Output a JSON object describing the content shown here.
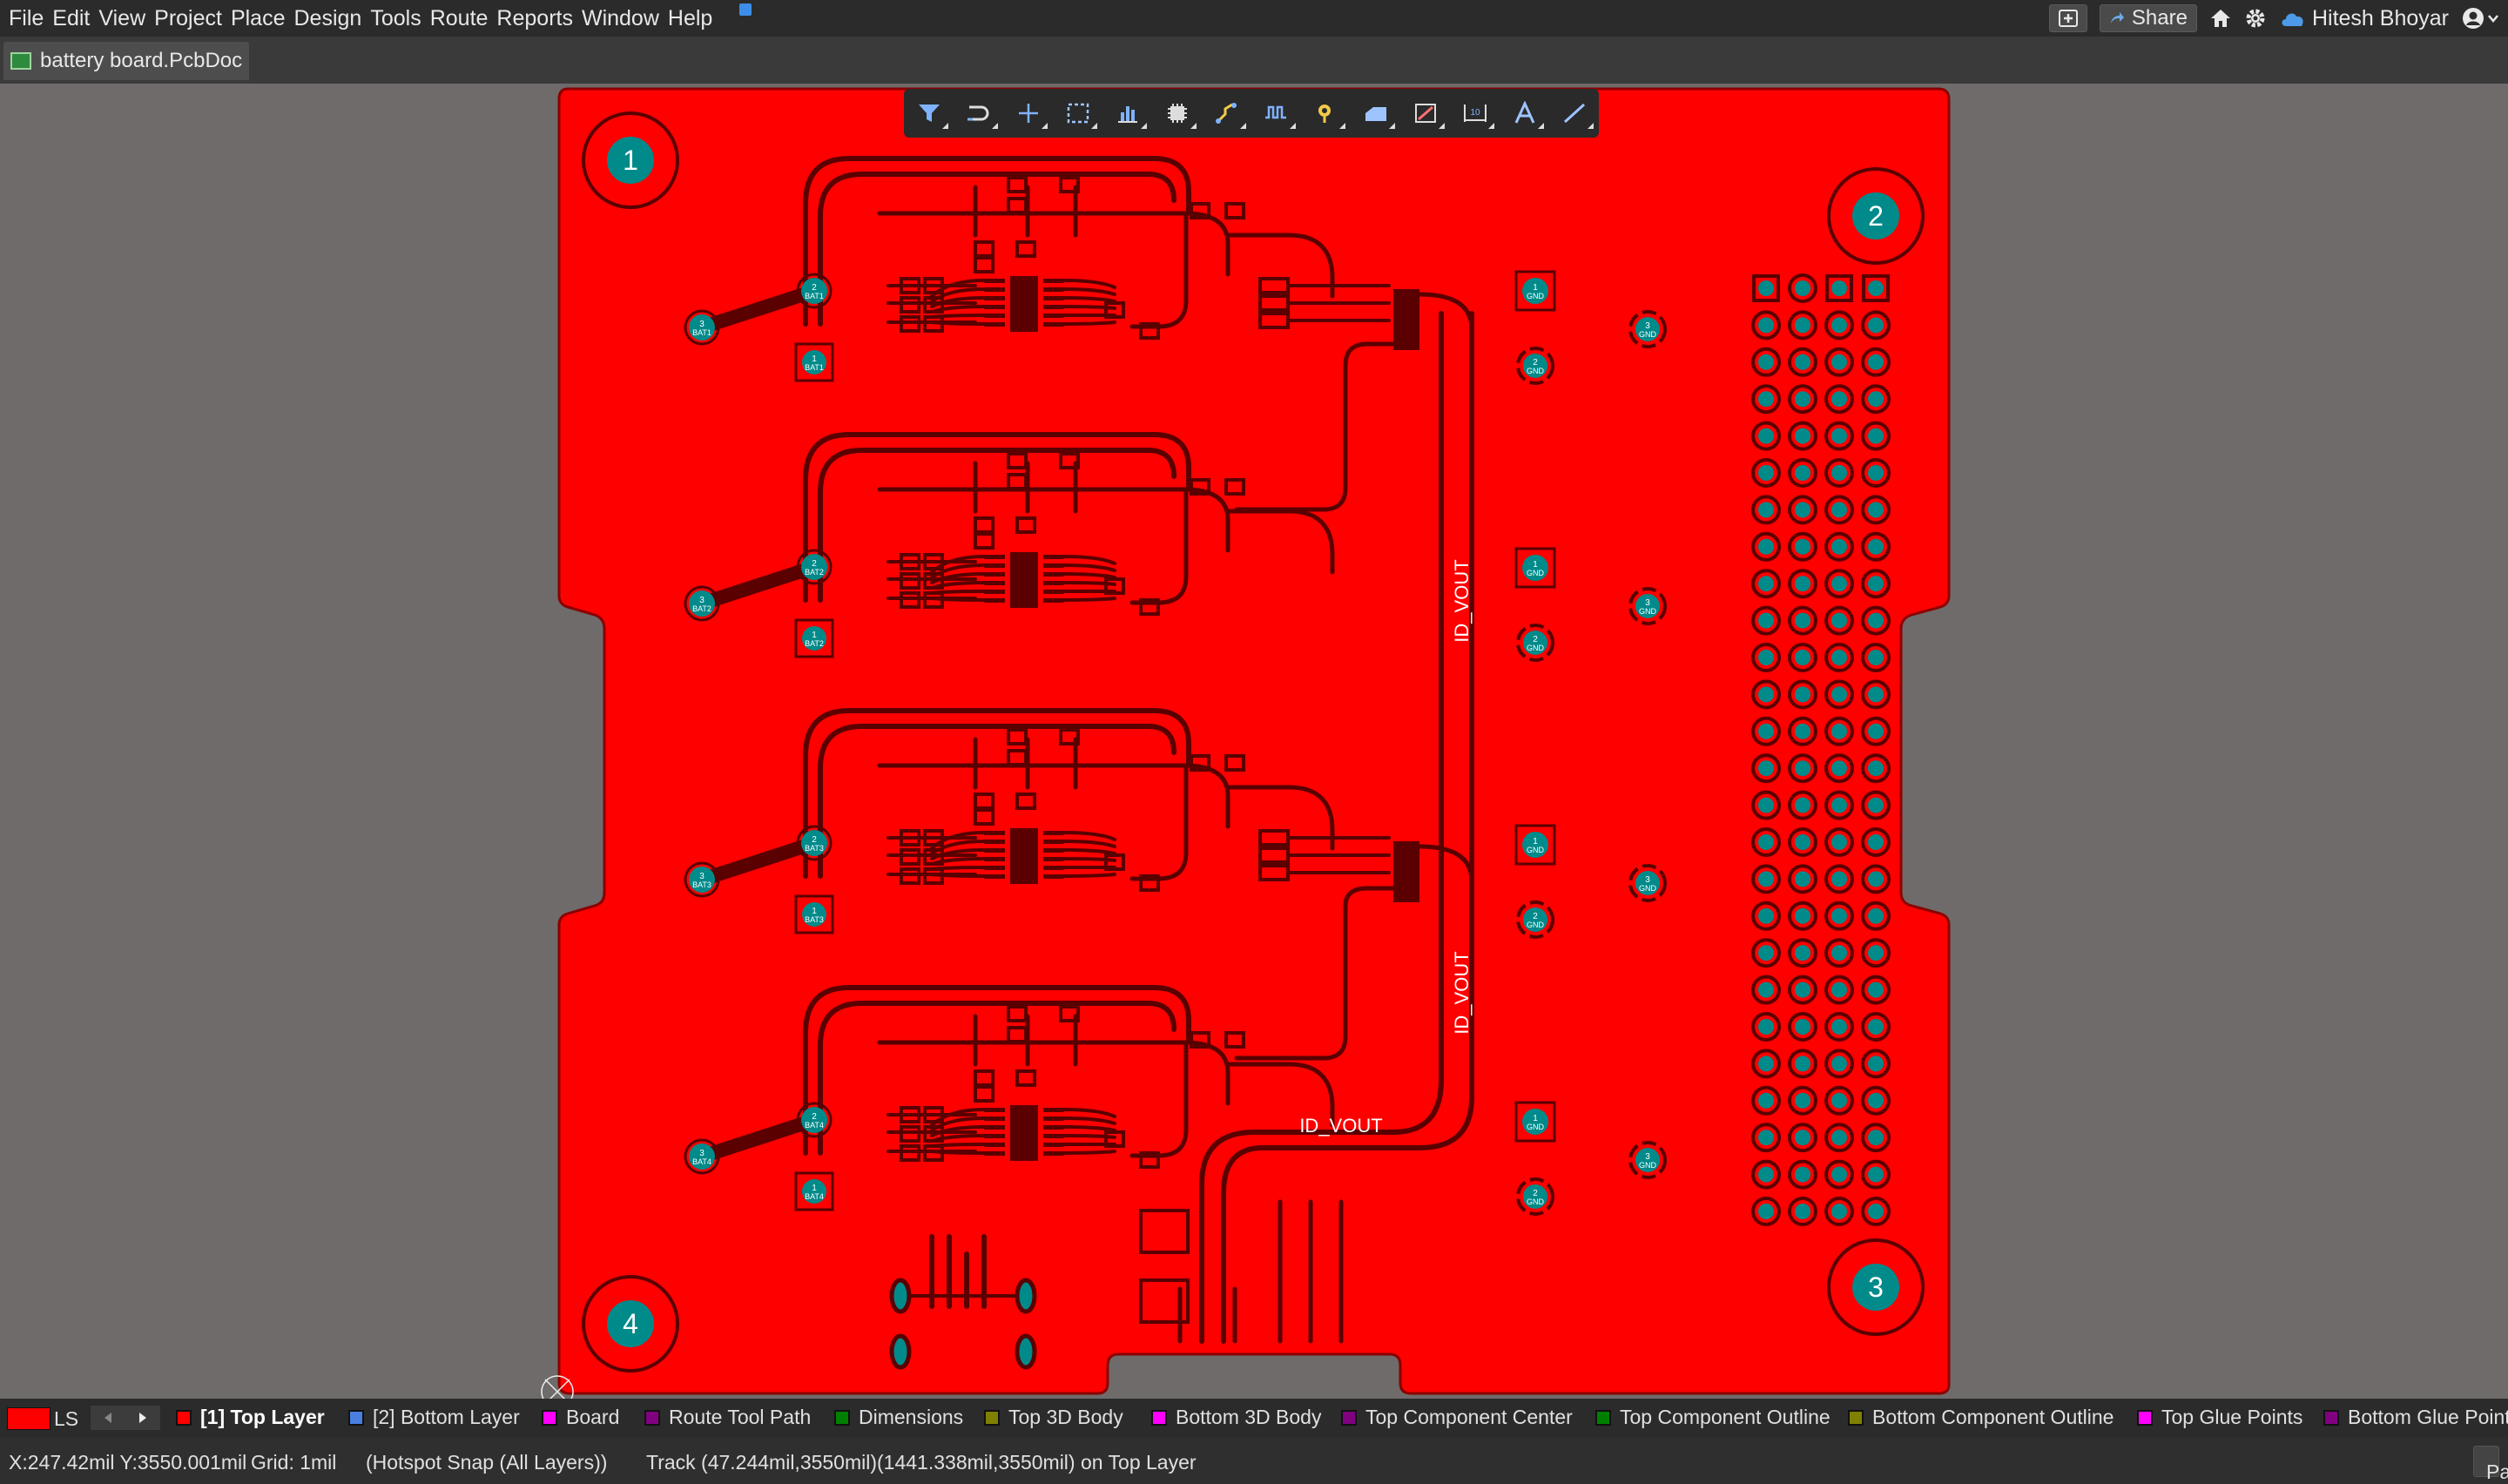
{
  "menu": [
    "File",
    "Edit",
    "View",
    "Project",
    "Place",
    "Design",
    "Tools",
    "Route",
    "Reports",
    "Window",
    "Help"
  ],
  "topbar": {
    "share_label": "Share",
    "user_name": "Hitesh Bhoyar"
  },
  "document_tab": {
    "label": "battery board.PcbDoc"
  },
  "toolbar_icons": [
    "filter-icon",
    "interactive-route-icon",
    "cross-icon",
    "select-rect-icon",
    "chart-icon",
    "component-icon",
    "route-icon",
    "length-tune-icon",
    "via-icon",
    "polygon-icon",
    "keepout-icon",
    "dimension-icon",
    "text-icon",
    "line-icon"
  ],
  "board": {
    "mount_holes": [
      "1",
      "2",
      "3",
      "4"
    ],
    "net_labels": [
      "ID_VOUT",
      "ID_VOUT",
      "ID_VOUT"
    ],
    "battery_groups": [
      {
        "pad2": "2",
        "net2": "BAT1",
        "pad3": "3",
        "net3": "BAT1",
        "pad1": "1",
        "net1": "BAT1"
      },
      {
        "pad2": "2",
        "net2": "BAT2",
        "pad3": "3",
        "net3": "BAT2",
        "pad1": "1",
        "net1": "BAT2"
      },
      {
        "pad2": "2",
        "net2": "BAT3",
        "pad3": "3",
        "net3": "BAT3",
        "pad1": "1",
        "net1": "BAT3"
      },
      {
        "pad2": "2",
        "net2": "BAT4",
        "pad3": "3",
        "net3": "BAT4",
        "pad1": "1",
        "net1": "BAT4"
      }
    ],
    "gnd_groups": [
      {
        "pad1": "1",
        "pad2": "2",
        "pad3": "3",
        "net": "GND"
      },
      {
        "pad1": "1",
        "pad2": "2",
        "pad3": "3",
        "net": "GND"
      },
      {
        "pad1": "1",
        "pad2": "2",
        "pad3": "3",
        "net": "GND"
      },
      {
        "pad1": "1",
        "pad2": "2",
        "pad3": "3",
        "net": "GND"
      }
    ],
    "colors": {
      "copper": "#ff0000",
      "background": "#6e6b6a",
      "pad": "#008a8a",
      "track": "#5a0000"
    }
  },
  "layer_bar": {
    "current_label": "LS",
    "layers": [
      {
        "label": "[1] Top Layer",
        "color": "#ff0000",
        "active": true
      },
      {
        "label": "[2] Bottom Layer",
        "color": "#4a7fe0"
      },
      {
        "label": "Board",
        "color": "#ff00ff"
      },
      {
        "label": "Route Tool Path",
        "color": "#800080"
      },
      {
        "label": "Dimensions",
        "color": "#008000"
      },
      {
        "label": "Top 3D Body",
        "color": "#808000"
      },
      {
        "label": "Bottom 3D Body",
        "color": "#ff00ff"
      },
      {
        "label": "Top Component Center",
        "color": "#800080"
      },
      {
        "label": "Top Component Outline",
        "color": "#008000"
      },
      {
        "label": "Bottom Component Outline",
        "color": "#808000"
      },
      {
        "label": "Top Glue Points",
        "color": "#ff00ff"
      },
      {
        "label": "Bottom Glue Points",
        "color": "#800080"
      }
    ]
  },
  "status": {
    "coords": "X:247.42mil Y:3550.001mil",
    "grid": "Grid: 1mil",
    "snap": "(Hotspot Snap (All Layers))",
    "info": "Track (47.244mil,3550mil)(1441.338mil,3550mil) on Top Layer",
    "panels_label": "Panels"
  }
}
